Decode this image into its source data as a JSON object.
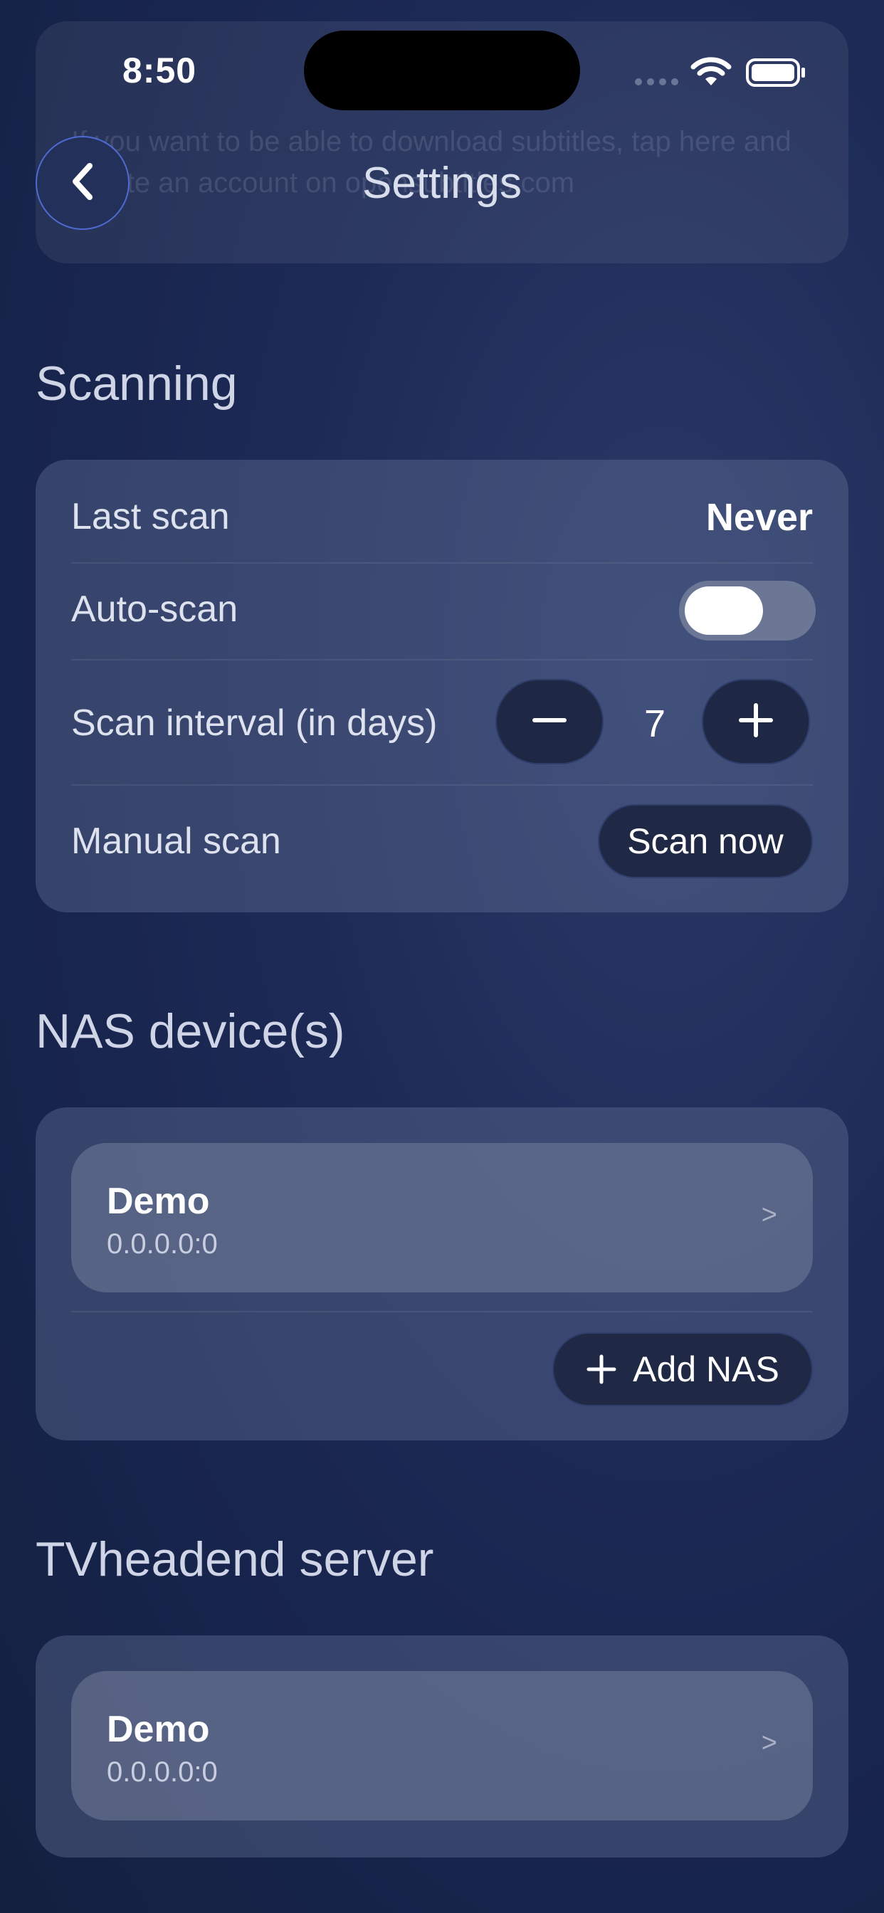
{
  "status_bar": {
    "time": "8:50"
  },
  "header": {
    "title": "Settings",
    "back_icon": "chevron-left-icon"
  },
  "faded_card": {
    "text": "If you want to be able to download subtitles, tap here and create an account on opensubtitles.com"
  },
  "scanning": {
    "title": "Scanning",
    "last_scan_label": "Last scan",
    "last_scan_value": "Never",
    "auto_scan_label": "Auto-scan",
    "auto_scan_on": true,
    "interval_label": "Scan interval (in days)",
    "interval_value": "7",
    "manual_label": "Manual scan",
    "scan_now_label": "Scan now"
  },
  "nas": {
    "title": "NAS device(s)",
    "devices": [
      {
        "name": "Demo",
        "address": "0.0.0.0:0",
        "chevron": ">"
      }
    ],
    "add_label": "Add NAS"
  },
  "tvheadend": {
    "title": "TVheadend server",
    "servers": [
      {
        "name": "Demo",
        "address": "0.0.0.0:0",
        "chevron": ">"
      }
    ]
  },
  "colors": {
    "background": "#1d2a56",
    "card": "#3a4567",
    "button_dark": "#1f2845",
    "back_button_border": "#4d6bd0"
  }
}
